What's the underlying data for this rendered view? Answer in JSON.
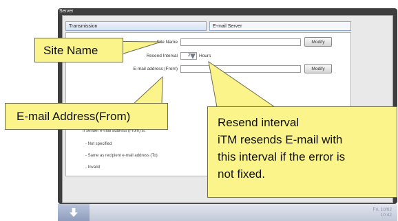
{
  "window": {
    "title": "Server"
  },
  "tabs": [
    {
      "label": "Transmission"
    },
    {
      "label": "E-mail Server"
    }
  ],
  "form": {
    "site_name_label": "Site Name",
    "site_name_value": "",
    "modify1": "Modify",
    "resend_label": "Resend Interval",
    "resend_value": "2",
    "resend_unit": "Hours",
    "email_label": "E-mail address (From)",
    "email_value": "",
    "modify2": "Modify"
  },
  "hints": {
    "title": "If sender e-mail address (From) is:",
    "items": [
      "- Not specified",
      "- Same as recipient e-mail address (To)",
      "- Invalid"
    ]
  },
  "taskbar": {
    "date": "Fri, 10/02",
    "time": "10:42"
  },
  "callouts": {
    "site_name": "Site Name",
    "email_from": "E-mail Address(From)",
    "resend_lines": [
      "Resend interval",
      "iTM resends E-mail with",
      "this interval if the error is",
      "not fixed."
    ]
  },
  "colors": {
    "callout_fill": "#fbf48a",
    "window_frame": "#3e3e3e",
    "tab_accent": "#8fa8c8"
  }
}
